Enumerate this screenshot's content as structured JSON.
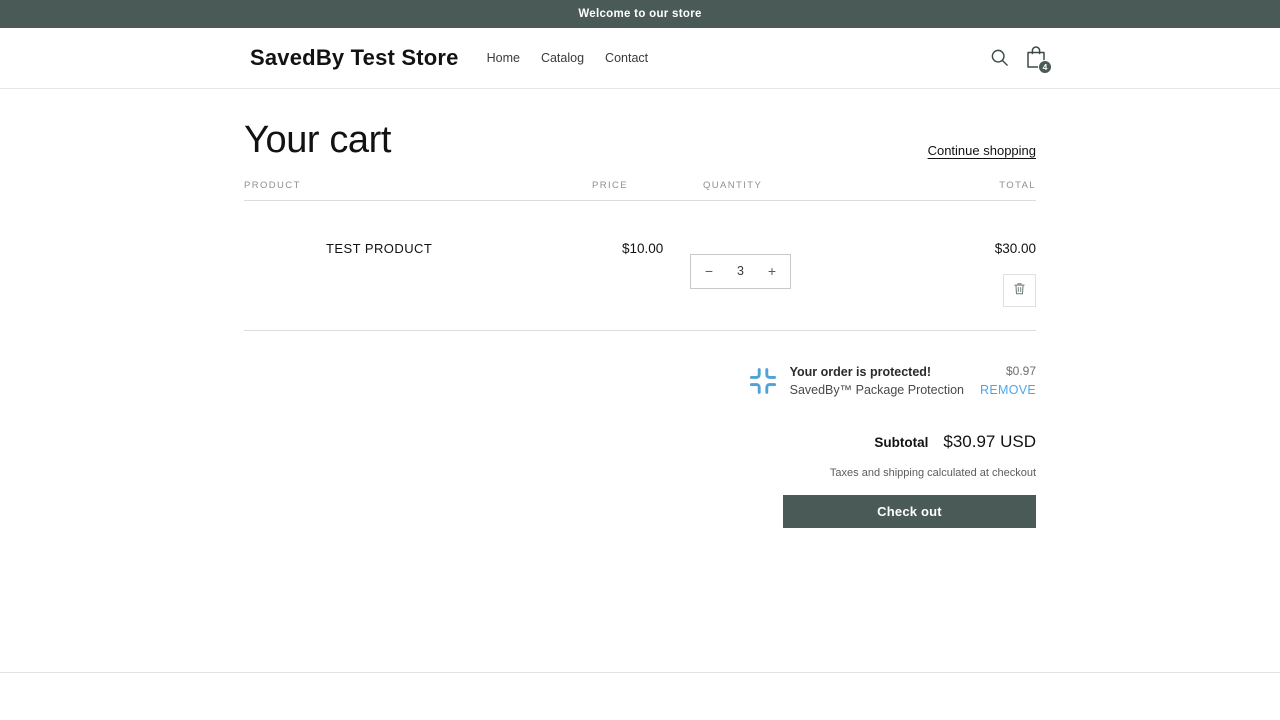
{
  "announcement": {
    "text": "Welcome to our store"
  },
  "header": {
    "brand": "SavedBy Test Store",
    "nav": [
      {
        "label": "Home"
      },
      {
        "label": "Catalog"
      },
      {
        "label": "Contact"
      }
    ],
    "search_icon": "search-icon",
    "cart_icon": "shopping-bag-icon",
    "cart_count": "4"
  },
  "cart": {
    "title": "Your cart",
    "continue_shopping": "Continue shopping",
    "columns": {
      "product": "PRODUCT",
      "price": "PRICE",
      "quantity": "QUANTITY",
      "total": "TOTAL"
    },
    "items": [
      {
        "title": "TEST PRODUCT",
        "price": "$10.00",
        "quantity": "3",
        "decrease_label": "−",
        "increase_label": "+",
        "total": "$30.00",
        "remove_icon": "trash-icon"
      }
    ]
  },
  "protection": {
    "logo_icon": "savedby-logo-icon",
    "headline": "Your order is protected!",
    "subtitle": "SavedBy™ Package Protection",
    "price": "$0.97",
    "remove_label": "REMOVE"
  },
  "summary": {
    "subtotal_label": "Subtotal",
    "subtotal_value": "$30.97 USD",
    "tax_note": "Taxes and shipping calculated at checkout",
    "checkout_label": "Check out"
  },
  "colors": {
    "brand_dark": "#4a5a57",
    "accent_blue": "#4aa7ee",
    "logo_blue": "#4fa3d8",
    "text": "#121212",
    "muted": "#8f8f8f"
  }
}
